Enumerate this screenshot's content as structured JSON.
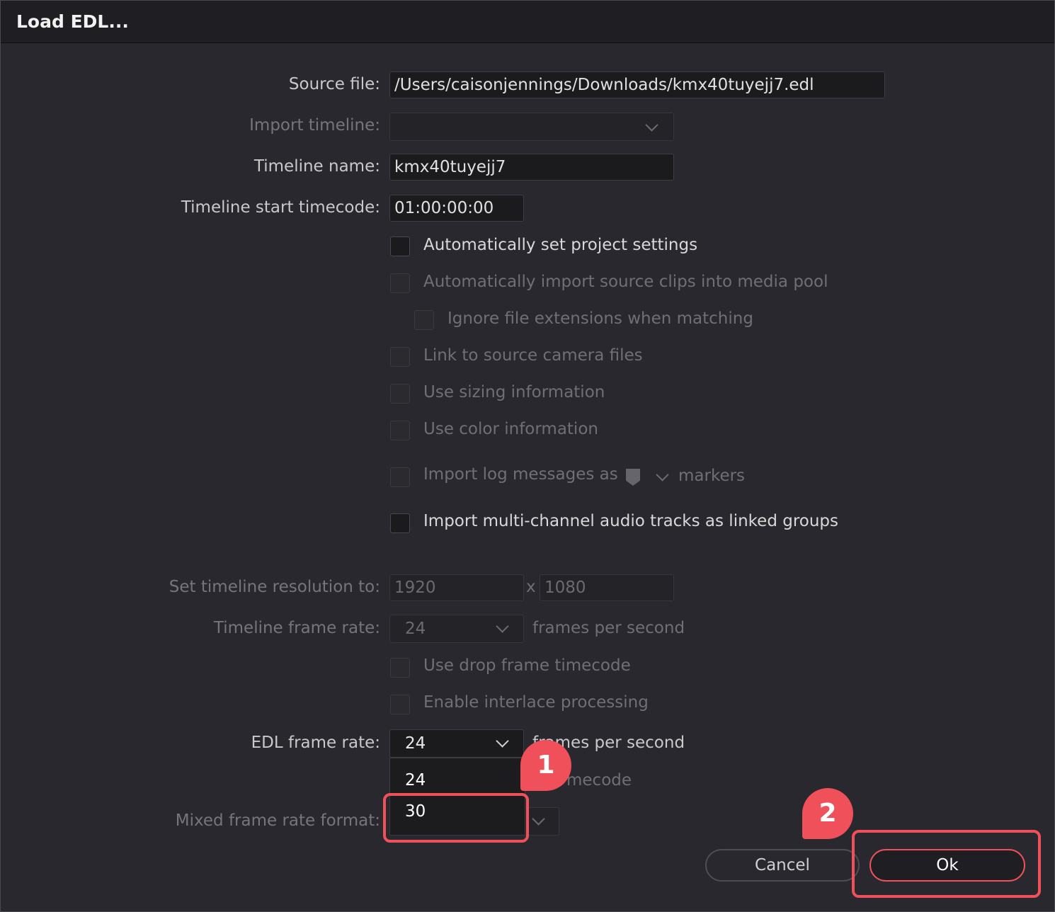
{
  "window": {
    "title": "Load EDL..."
  },
  "source_file": {
    "label": "Source file:",
    "value": "/Users/caisonjennings/Downloads/kmx40tuyejj7.edl"
  },
  "import_timeline": {
    "label": "Import timeline:",
    "value": ""
  },
  "timeline_name": {
    "label": "Timeline name:",
    "value": "kmx40tuyejj7"
  },
  "timeline_start_timecode": {
    "label": "Timeline start timecode:",
    "value": "01:00:00:00"
  },
  "options": {
    "auto_project_settings": "Automatically set project settings",
    "auto_import_clips": "Automatically import source clips into media pool",
    "ignore_extensions": "Ignore file extensions when matching",
    "link_camera_files": "Link to source camera files",
    "use_sizing": "Use sizing information",
    "use_color": "Use color information",
    "import_log_messages": "Import log messages as",
    "markers_suffix": "markers",
    "multichannel_audio": "Import multi-channel audio tracks as linked groups"
  },
  "resolution": {
    "label": "Set timeline resolution to:",
    "width": "1920",
    "separator": "x",
    "height": "1080"
  },
  "timeline_frame_rate": {
    "label": "Timeline frame rate:",
    "value": "24",
    "unit": "frames per second"
  },
  "drop_frame": "Use drop frame timecode",
  "interlace": "Enable interlace processing",
  "edl_frame_rate": {
    "label": "EDL frame rate:",
    "value": "24",
    "unit": "frames per second",
    "options": [
      "24",
      "30"
    ]
  },
  "edl_drop_frame_partial": "mecode",
  "mixed_frame_rate": {
    "label": "Mixed frame rate format:"
  },
  "annotations": {
    "step1": "1",
    "step2": "2"
  },
  "buttons": {
    "cancel": "Cancel",
    "ok": "Ok"
  },
  "colors": {
    "accent": "#f0505a",
    "background": "#28282e"
  }
}
